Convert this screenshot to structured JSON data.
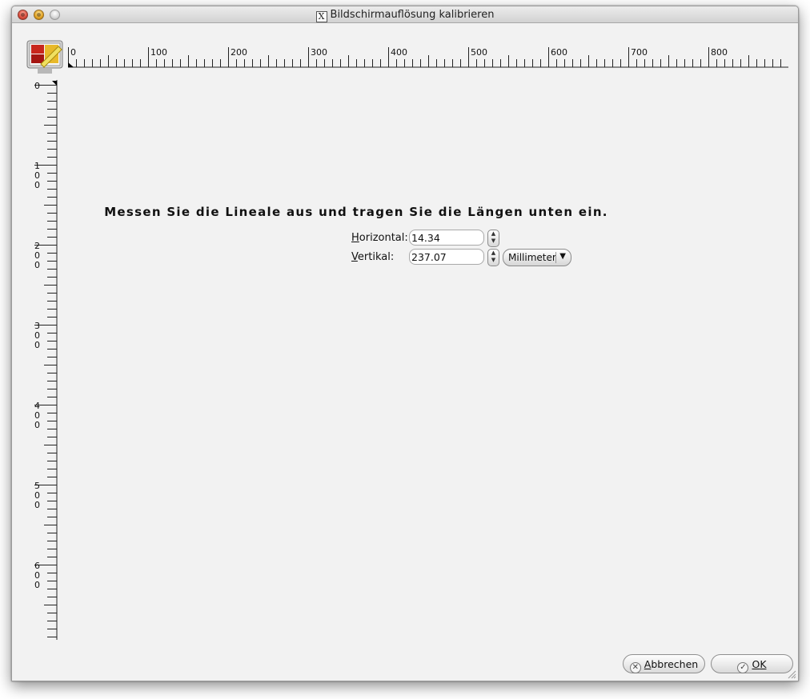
{
  "window": {
    "title": "Bildschirmauflösung kalibrieren"
  },
  "titlebar": {
    "x_icon": "X"
  },
  "ruler": {
    "horizontal_labels": [
      "0",
      "100",
      "200",
      "300",
      "400",
      "500",
      "600",
      "700",
      "800"
    ],
    "vertical_labels": [
      "0",
      "100",
      "200",
      "300",
      "400",
      "500",
      "600"
    ]
  },
  "instruction": "Messen Sie die Lineale aus und tragen Sie die Längen unten ein.",
  "form": {
    "horizontal": {
      "mnemonic": "H",
      "label_rest": "orizontal:",
      "value": "14.34"
    },
    "vertical": {
      "mnemonic": "V",
      "label_rest": "ertikal:",
      "value": "237.07"
    },
    "unit": "Millimeter"
  },
  "buttons": {
    "cancel": {
      "mnemonic": "A",
      "label_rest": "bbrechen"
    },
    "ok": {
      "mnemonic": "O",
      "label_rest": "K"
    }
  },
  "icons": {
    "app": "display-calibration-icon",
    "cancel": "cancel-circle-icon",
    "ok": "checkmark-circle-icon",
    "spin": "spin-arrows-icon",
    "dropdown": "chevron-down-icon",
    "resize": "resize-grip-icon"
  }
}
